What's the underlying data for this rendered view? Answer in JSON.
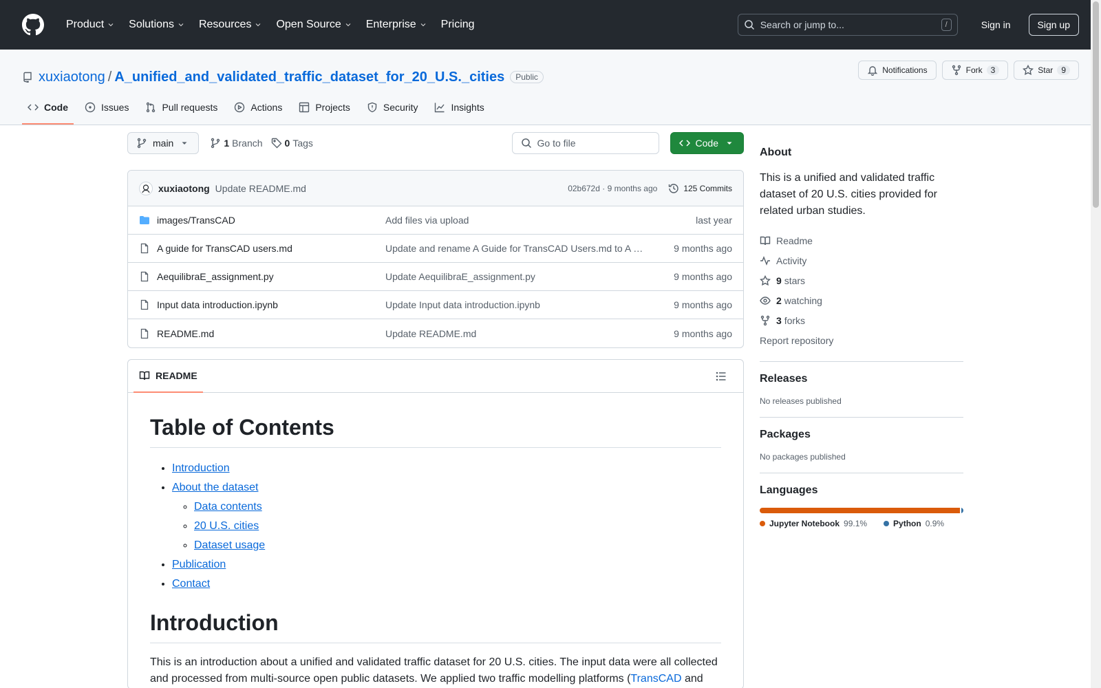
{
  "topnav": {
    "items": [
      {
        "label": "Product",
        "dropdown": true
      },
      {
        "label": "Solutions",
        "dropdown": true
      },
      {
        "label": "Resources",
        "dropdown": true
      },
      {
        "label": "Open Source",
        "dropdown": true
      },
      {
        "label": "Enterprise",
        "dropdown": true
      },
      {
        "label": "Pricing",
        "dropdown": false
      }
    ],
    "search_placeholder": "Search or jump to...",
    "search_shortcut": "/",
    "signin": "Sign in",
    "signup": "Sign up"
  },
  "repo": {
    "owner": "xuxiaotong",
    "separator": "/",
    "name": "A_unified_and_validated_traffic_dataset_for_20_U.S._cities",
    "visibility": "Public",
    "notifications": "Notifications",
    "fork_label": "Fork",
    "fork_count": "3",
    "star_label": "Star",
    "star_count": "9"
  },
  "tabs": [
    "Code",
    "Issues",
    "Pull requests",
    "Actions",
    "Projects",
    "Security",
    "Insights"
  ],
  "filebar": {
    "branch": "main",
    "branch_count": "1",
    "branch_label": "Branch",
    "tag_count": "0",
    "tag_label": "Tags",
    "goto_placeholder": "Go to file",
    "code_label": "Code"
  },
  "commit": {
    "author": "xuxiaotong",
    "message": "Update README.md",
    "hash": "02b672d",
    "dot": "·",
    "time": "9 months ago",
    "commits": "125 Commits"
  },
  "files": [
    {
      "name": "images/TransCAD",
      "type": "folder",
      "message": "Add files via upload",
      "date": "last year"
    },
    {
      "name": "A guide for TransCAD users.md",
      "type": "file",
      "message": "Update and rename A Guide for TransCAD Users.md to A guide for TransCAD users.md",
      "date": "9 months ago"
    },
    {
      "name": "AequilibraE_assignment.py",
      "type": "file",
      "message": "Update AequilibraE_assignment.py",
      "date": "9 months ago"
    },
    {
      "name": "Input data introduction.ipynb",
      "type": "file",
      "message": "Update Input data introduction.ipynb",
      "date": "9 months ago"
    },
    {
      "name": "README.md",
      "type": "file",
      "message": "Update README.md",
      "date": "9 months ago"
    }
  ],
  "readme": {
    "tab": "README",
    "toc_title": "Table of Contents",
    "toc": [
      "Introduction",
      "About the dataset",
      "Data contents",
      "20 U.S. cities",
      "Dataset usage",
      "Publication",
      "Contact"
    ],
    "intro_title": "Introduction",
    "intro_text_1": "This is an introduction about a unified and validated traffic dataset for 20 U.S. cities. The input data were all collected and processed from multi-source open public datasets. We applied two traffic modelling platforms (",
    "intro_link": "TransCAD",
    "intro_text_2": " and"
  },
  "about": {
    "title": "About",
    "description": "This is a unified and validated traffic dataset of 20 U.S. cities provided for related urban studies.",
    "readme": "Readme",
    "activity": "Activity",
    "stars_count": "9",
    "stars_label": "stars",
    "watching_count": "2",
    "watching_label": "watching",
    "forks_count": "3",
    "forks_label": "forks",
    "report": "Report repository"
  },
  "releases": {
    "title": "Releases",
    "empty": "No releases published"
  },
  "packages": {
    "title": "Packages",
    "empty": "No packages published"
  },
  "languages": {
    "title": "Languages",
    "items": [
      {
        "name": "Jupyter Notebook",
        "percent": "99.1%",
        "value": 99.1,
        "color": "#DA5B0B"
      },
      {
        "name": "Python",
        "percent": "0.9%",
        "value": 0.9,
        "color": "#3572A5"
      }
    ]
  }
}
